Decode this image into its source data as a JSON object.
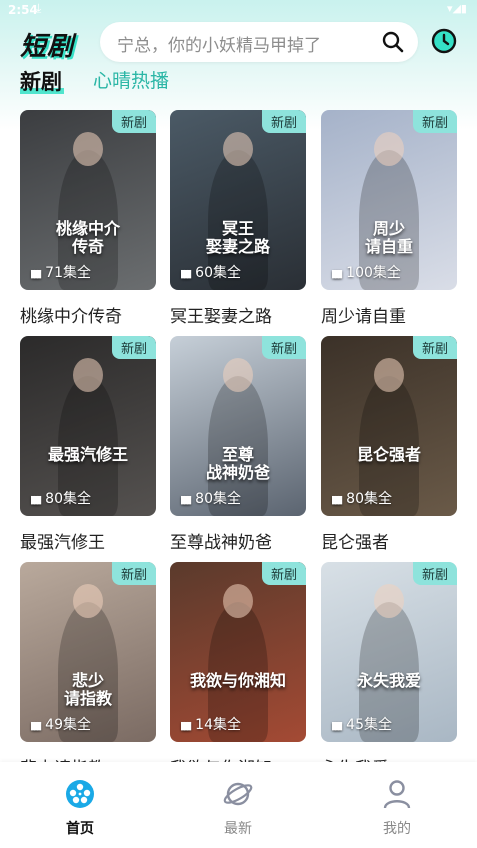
{
  "status_bar": {
    "time": "2:54",
    "download_icon": "download-icon",
    "icons": "wifi-icon signal-icon battery-icon"
  },
  "header": {
    "logo_text": "短剧",
    "search_placeholder": "宁总，你的小妖精马甲掉了",
    "search_icon": "search-icon",
    "history_icon": "history-icon"
  },
  "tabs": [
    {
      "label": "新剧",
      "active": true
    },
    {
      "label": "心晴热播",
      "active": false
    }
  ],
  "badge_label": "新剧",
  "dramas": [
    {
      "title": "桃缘中介传奇",
      "episodes": "71集全",
      "poster_text": "桃缘中介\n传奇",
      "bg": [
        "#3b3d40",
        "#6b6e70"
      ]
    },
    {
      "title": "冥王娶妻之路",
      "episodes": "60集全",
      "poster_text": "冥王\n娶妻之路",
      "bg": [
        "#4b5a66",
        "#2a2f35"
      ]
    },
    {
      "title": "周少请自重",
      "episodes": "100集全",
      "poster_text": "周少\n请自重",
      "bg": [
        "#a5b2c9",
        "#d9dde7"
      ]
    },
    {
      "title": "最强汽修王",
      "episodes": "80集全",
      "poster_text": "最强汽修王",
      "bg": [
        "#2b2a2a",
        "#555250"
      ]
    },
    {
      "title": "至尊战神奶爸",
      "episodes": "80集全",
      "poster_text": "至尊\n战神奶爸",
      "bg": [
        "#c6cfd8",
        "#5b6470"
      ]
    },
    {
      "title": "昆仑强者",
      "episodes": "80集全",
      "poster_text": "昆仑强者",
      "bg": [
        "#3b3128",
        "#6a5a48"
      ]
    },
    {
      "title": "悲少请指教",
      "episodes": "49集全",
      "poster_text": "悲少\n请指教",
      "bg": [
        "#b9a99c",
        "#7b6b63"
      ]
    },
    {
      "title": "我欲与你湘知",
      "episodes": "14集全",
      "poster_text": "我欲与你湘知",
      "bg": [
        "#5a3a2c",
        "#a44a34"
      ]
    },
    {
      "title": "永失我爱",
      "episodes": "45集全",
      "poster_text": "永失我爱",
      "bg": [
        "#d8e0e6",
        "#a9b7c4"
      ]
    }
  ],
  "bottom_nav": [
    {
      "label": "首页",
      "icon": "film-reel-icon",
      "active": true
    },
    {
      "label": "最新",
      "icon": "planet-icon",
      "active": false
    },
    {
      "label": "我的",
      "icon": "user-icon",
      "active": false
    }
  ],
  "colors": {
    "accent": "#35e0c6",
    "badge": "#8ee3dc"
  }
}
